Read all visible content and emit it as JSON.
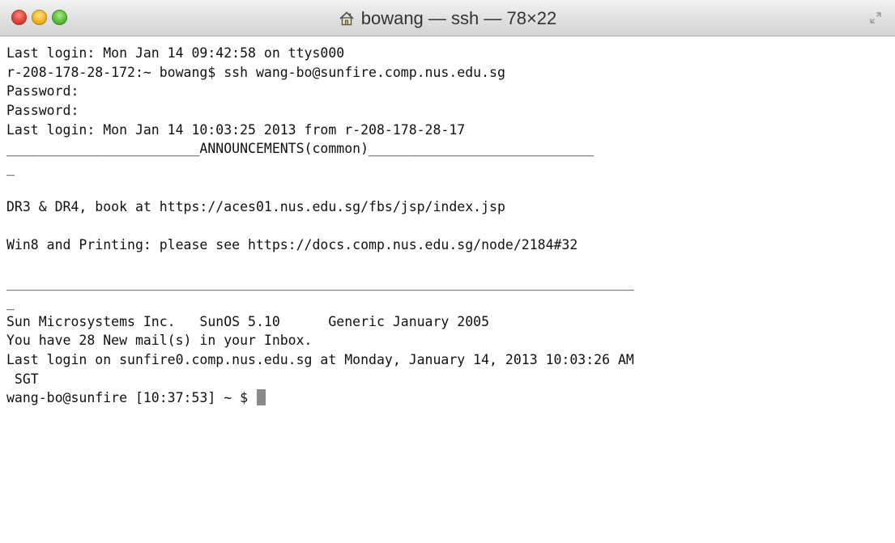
{
  "window": {
    "title": "bowang — ssh — 78×22",
    "title_icon": "home-icon",
    "controls": [
      "close",
      "minimize",
      "zoom"
    ],
    "colors": {
      "close": "#e0443a",
      "minimize": "#f3b42c",
      "zoom": "#5cbf3a",
      "cursor": "#8a8a8a"
    }
  },
  "terminal": {
    "lines": [
      "Last login: Mon Jan 14 09:42:58 on ttys000",
      "r-208-178-28-172:~ bowang$ ssh wang-bo@sunfire.comp.nus.edu.sg",
      "Password:",
      "Password:",
      "Last login: Mon Jan 14 10:03:25 2013 from r-208-178-28-17",
      "________________________ANNOUNCEMENTS(common)____________________________",
      "_",
      "",
      "DR3 & DR4, book at https://aces01.nus.edu.sg/fbs/jsp/index.jsp",
      "",
      "Win8 and Printing: please see https://docs.comp.nus.edu.sg/node/2184#32",
      "",
      "______________________________________________________________________________",
      "_",
      "Sun Microsystems Inc.   SunOS 5.10      Generic January 2005",
      "You have 28 New mail(s) in your Inbox.",
      "Last login on sunfire0.comp.nus.edu.sg at Monday, January 14, 2013 10:03:26 AM",
      " SGT"
    ],
    "prompt": "wang-bo@sunfire [10:37:53] ~ $ "
  }
}
